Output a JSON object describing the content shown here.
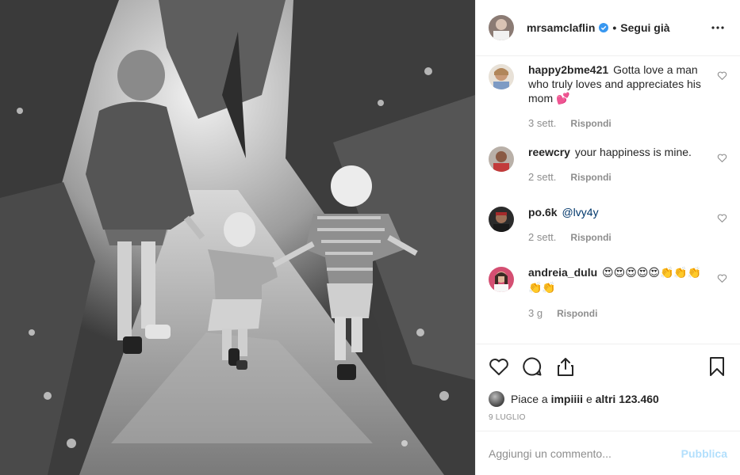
{
  "post": {
    "username": "mrsamclaflin",
    "follow_label": "Segui già",
    "separator": "•"
  },
  "comments": [
    {
      "username": "happy2bme421",
      "text": "Gotta love a man who truly loves and appreciates his mom 💕",
      "time": "3 sett.",
      "reply": "Rispondi"
    },
    {
      "username": "reewcry",
      "text": "your happiness is mine.",
      "time": "2 sett.",
      "reply": "Rispondi"
    },
    {
      "username": "po.6k",
      "text": "@lvy4y",
      "time": "2 sett.",
      "reply": "Rispondi"
    },
    {
      "username": "andreia_dulu",
      "text": "😍😍😍😍😍👏👏👏👏👏",
      "time": "3 g",
      "reply": "Rispondi"
    }
  ],
  "likes": {
    "prefix": "Piace a",
    "first_user": "impiiii",
    "middle": "e",
    "others": "altri 123.460"
  },
  "date": "9 LUGLIO",
  "comment_box": {
    "placeholder": "Aggiungi un commento...",
    "publish_label": "Pubblica"
  },
  "icons": {
    "more": "more-options-icon",
    "like": "heart-icon",
    "comment": "comment-bubble-icon",
    "share": "share-icon",
    "save": "bookmark-icon",
    "verified": "verified-badge-icon"
  },
  "colors": {
    "verified": "#3897f0",
    "publish_disabled": "#b2dffc",
    "secondary_text": "#8e8e8e",
    "border": "#efefef"
  }
}
